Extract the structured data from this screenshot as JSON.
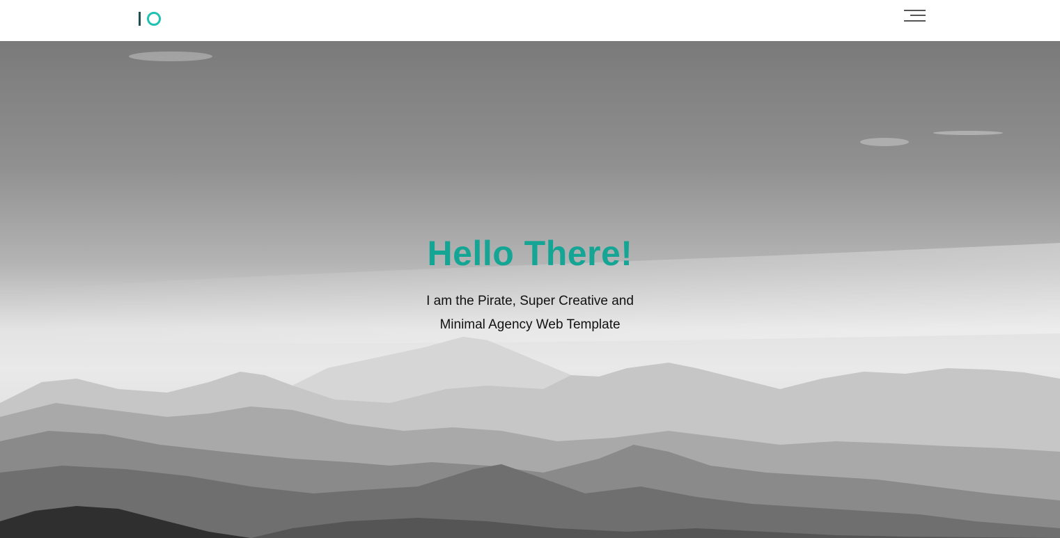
{
  "header": {
    "logo": {
      "name": "io-logo",
      "colors": {
        "bar": "#1f4f55",
        "ring": "#1fc1b0"
      }
    },
    "menu_icon": "hamburger-menu-icon"
  },
  "hero": {
    "background": "grayscale-mountain-landscape-photo",
    "title": "Hello There!",
    "subtitle_line1": "I am the Pirate, Super Creative and",
    "subtitle_line2": "Minimal Agency Web Template",
    "title_color": "#15a595"
  }
}
